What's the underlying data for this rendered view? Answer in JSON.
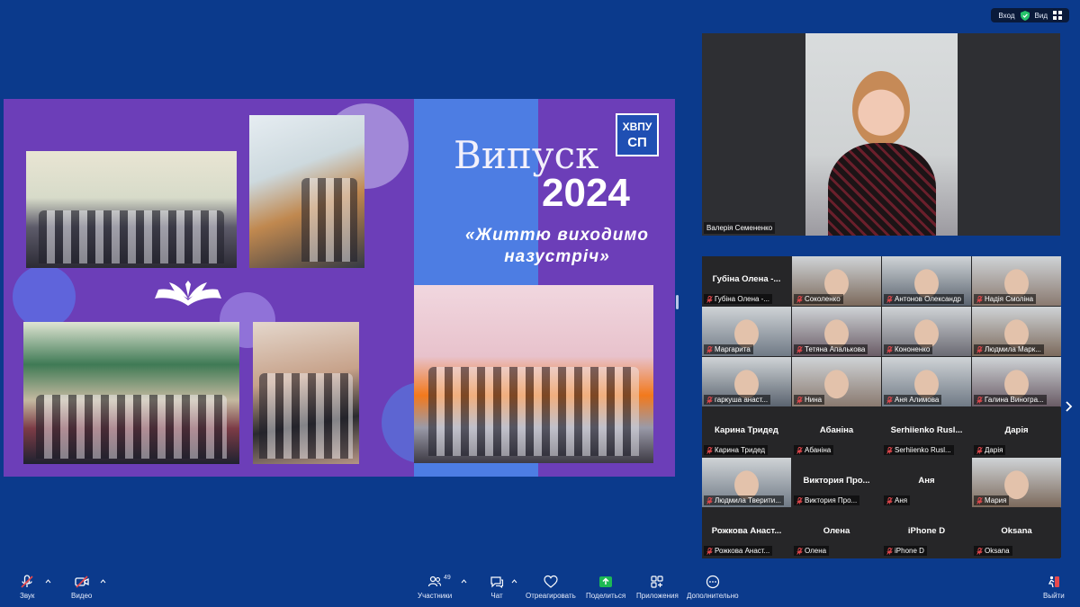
{
  "top": {
    "login_label": "Вход",
    "view_label": "Вид"
  },
  "slide": {
    "title": "Випуск",
    "year": "2024",
    "subtitle_line1": "«Життю виходимо",
    "subtitle_line2": "назустріч»",
    "logo_top": "ХВПУ",
    "logo_bottom": "СП"
  },
  "speaker": {
    "name": "Валерія Семененко"
  },
  "gallery": [
    {
      "big": "Губіна Олена -...",
      "label": "Губіна Олена -...",
      "video": false
    },
    {
      "big": "",
      "label": "Соколенко",
      "video": true
    },
    {
      "big": "",
      "label": "Антонов Олександр",
      "video": true
    },
    {
      "big": "",
      "label": "Надія Смоліна",
      "video": true
    },
    {
      "big": "",
      "label": "Маргарита",
      "video": true
    },
    {
      "big": "",
      "label": "Тетяна Апалькова",
      "video": true
    },
    {
      "big": "",
      "label": "Кононенко",
      "video": true
    },
    {
      "big": "",
      "label": "Людмила Марк...",
      "video": true
    },
    {
      "big": "",
      "label": "гаркуша анаст...",
      "video": true
    },
    {
      "big": "",
      "label": "Нина",
      "video": true
    },
    {
      "big": "",
      "label": "Аня Алимова",
      "video": true
    },
    {
      "big": "",
      "label": "Галина Виногра...",
      "video": true
    },
    {
      "big": "Карина Тридед",
      "label": "Карина Тридед",
      "video": false
    },
    {
      "big": "Абаніна",
      "label": "Абаніна",
      "video": false
    },
    {
      "big": "Serhiienko Rusl...",
      "label": "Serhiienko Rusl...",
      "video": false
    },
    {
      "big": "Дарія",
      "label": "Дарія",
      "video": false
    },
    {
      "big": "",
      "label": "Людмила Тверити...",
      "video": true
    },
    {
      "big": "Виктория Про...",
      "label": "Виктория Про...",
      "video": false
    },
    {
      "big": "Аня",
      "label": "Аня",
      "video": false
    },
    {
      "big": "",
      "label": "Мария",
      "video": true
    },
    {
      "big": "Рожкова Анаст...",
      "label": "Рожкова Анаст...",
      "video": false
    },
    {
      "big": "Олена",
      "label": "Олена",
      "video": false
    },
    {
      "big": "iPhone D",
      "label": "iPhone D",
      "video": false
    },
    {
      "big": "Oksana",
      "label": "Oksana",
      "video": false
    }
  ],
  "toolbar": {
    "audio": "Звук",
    "video": "Видео",
    "participants": "Участники",
    "participants_count": "49",
    "chat": "Чат",
    "react": "Отреагировать",
    "share": "Поделиться",
    "apps": "Приложения",
    "more": "Дополнительно",
    "leave": "Выйти"
  },
  "colors": {
    "background": "#0b3a8c",
    "slide_purple": "#6c3eb8",
    "slide_blue": "#4d7de3",
    "share_green": "#1db954",
    "mute_red": "#e5484d"
  }
}
